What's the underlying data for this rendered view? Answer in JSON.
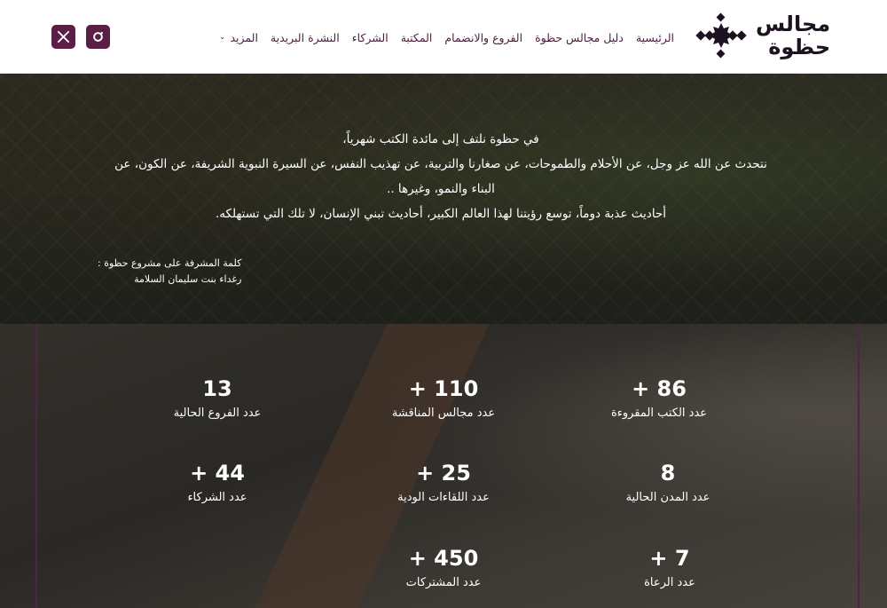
{
  "header": {
    "logo": {
      "line1": "مجالس",
      "line2": "حظوة"
    },
    "nav": [
      {
        "label": "الرئيسية"
      },
      {
        "label": "دليل مجالس حظوة"
      },
      {
        "label": "الفروع والانضمام"
      },
      {
        "label": "المكتبة"
      },
      {
        "label": "الشركاء"
      },
      {
        "label": "النشرة البريدية"
      },
      {
        "label": "المزيد"
      }
    ],
    "social": [
      {
        "icon": "x-icon"
      },
      {
        "icon": "instagram-icon"
      }
    ]
  },
  "hero": {
    "lines": [
      "في حظوة نلتف إلى مائدة الكتب شهرياً،",
      "نتحدث عن الله عز وجل، عن الأحلام والطموحات، عن صغارنا والتربية، عن تهذيب النفس، عن السيرة النبوية الشريفة، عن الكون، عن",
      "البناء والنمو، وغيرها ..",
      "أحاديث عذبة دوماً، توسع رؤيتنا لهذا العالم الكبير، أحاديث تبني الإنسان، لا تلك التي تستهلكه."
    ],
    "signature_title": "كلمة المشرفة على مشروع حظوة :",
    "signature_name": "رغداء بنت سليمان السلامة"
  },
  "stats": [
    {
      "value": "86 +",
      "label": "عدد الكتب المقروءة"
    },
    {
      "value": "110 +",
      "label": "عدد مجالس المناقشة"
    },
    {
      "value": "13",
      "label": "عدد الفروع الحالية"
    },
    {
      "value": "8",
      "label": "عدد المدن الحالية"
    },
    {
      "value": "25 +",
      "label": "عدد اللقاءات الودية"
    },
    {
      "value": "44 +",
      "label": "عدد الشركاء"
    },
    {
      "value": "7 +",
      "label": "عدد الرعاة"
    },
    {
      "value": "450 +",
      "label": "عدد المشتركات"
    }
  ],
  "colors": {
    "brand": "#5a1f45",
    "nav_text": "#4a1f3d"
  }
}
